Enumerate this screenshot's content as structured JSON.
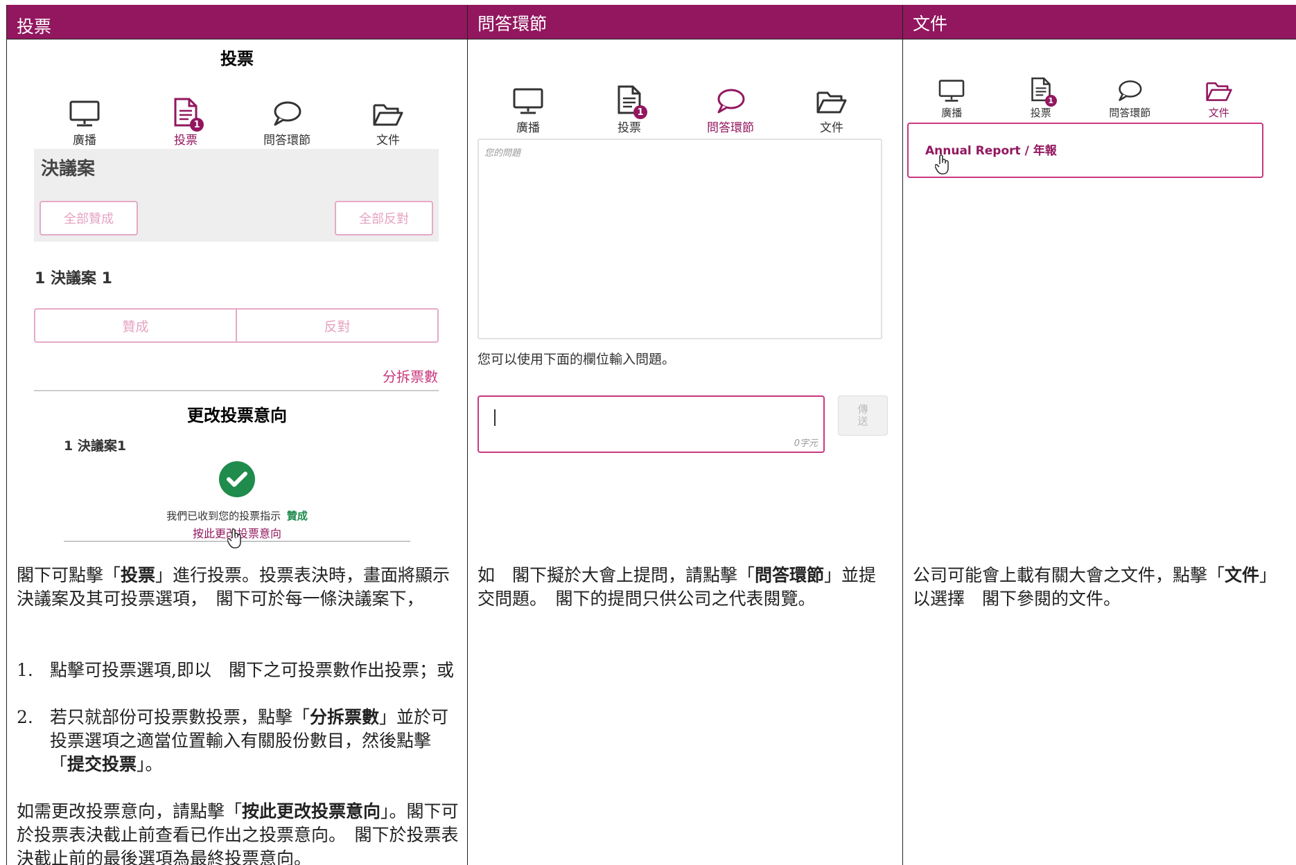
{
  "headers": [
    "投票",
    "問答環節",
    "文件"
  ],
  "vote_screen": {
    "top_title": "投票",
    "tabs": [
      {
        "label": "廣播",
        "icon": "monitor-icon"
      },
      {
        "label": "投票",
        "icon": "document-icon",
        "badge": "1"
      },
      {
        "label": "問答環節",
        "icon": "speech-bubble-icon"
      },
      {
        "label": "文件",
        "icon": "folder-icon"
      }
    ],
    "active_tab": 1,
    "resolutions_title": "決議案",
    "approve_all": "全部贊成",
    "reject_all": "全部反對",
    "resolution_label": "1 決議案 1",
    "for_label": "贊成",
    "against_label": "反對",
    "split_votes": "分拆票數",
    "change_title": "更改投票意向",
    "change_resolution": "1 決議案1",
    "received_text": "我們已收到您的投票指示",
    "received_choice": "贊成",
    "change_link": "按此更改投票意向"
  },
  "qa_screen": {
    "active_tab": 2,
    "question_box_label": "您的問題",
    "hint": "您可以使用下面的欄位輸入問題。",
    "counter": "0字元",
    "send": "傳送"
  },
  "docs_screen": {
    "active_tab": 3,
    "doc_link": "Annual Report / 年報"
  },
  "text": {
    "col1_intro_a": "閣下可點擊「",
    "col1_intro_b": "投票",
    "col1_intro_c": "」進行投票。投票表決時，畫面將顯示決議案及其可投票選項，　閣下可於每一條決議案下，",
    "item1_num": "1.",
    "item1": "點擊可投票選項,即以　閣下之可投票數作出投票；或",
    "item2_num": "2.",
    "item2_a": "若只就部份可投票數投票，點擊「",
    "item2_b": "分拆票數",
    "item2_c": "」並於可投票選項之適當位置輸入有關股份數目，然後點擊「",
    "item2_d": "提交投票",
    "item2_e": "」。",
    "col1_change_a": "如需更改投票意向，請點擊「",
    "col1_change_b": "按此更改投票意向",
    "col1_change_c": "」。閣下可於投票表決截止前查看已作出之投票意向。　閣下於投票表決截止前的最後選項為最終投票意向。",
    "col2_a": "如　閣下擬於大會上提問，請點擊「",
    "col2_b": "問答環節",
    "col2_c": "」並提交問題。　閣下的提問只供公司之代表閱覽。",
    "col3_a": "公司可能會上載有關大會之文件，點擊「",
    "col3_b": "文件",
    "col3_c": "」以選擇　閣下參閱的文件。"
  },
  "colors": {
    "brand": "#92175f",
    "accent": "#c9387e",
    "check": "#1f8b4c"
  }
}
